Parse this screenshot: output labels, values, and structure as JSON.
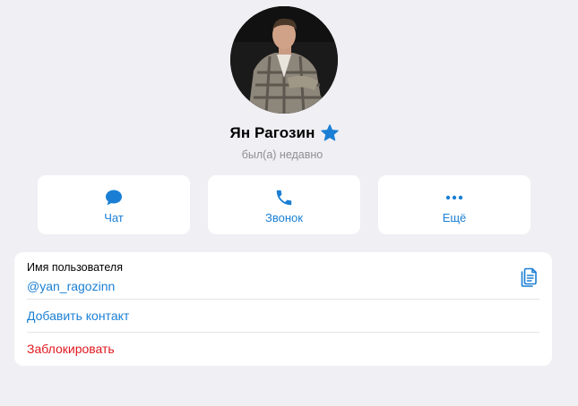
{
  "profile": {
    "name": "Ян Рагозин",
    "status": "был(а) недавно",
    "verified_icon": "star-icon"
  },
  "actions": [
    {
      "label": "Чат",
      "icon": "chat-bubble-icon"
    },
    {
      "label": "Звонок",
      "icon": "phone-icon"
    },
    {
      "label": "Ещё",
      "icon": "more-dots-icon"
    }
  ],
  "info": {
    "username_title": "Имя пользователя",
    "username_value": "@yan_ragozinn",
    "add_contact": "Добавить контакт",
    "block": "Заблокировать"
  },
  "colors": {
    "accent": "#1a7fd4",
    "danger": "#e0191f",
    "background": "#efeff4",
    "muted": "#8e8e93"
  }
}
